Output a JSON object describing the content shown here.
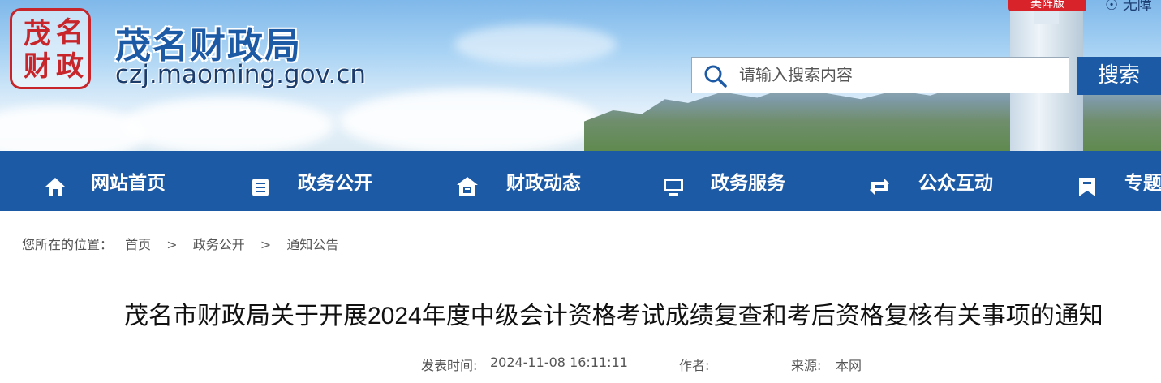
{
  "header": {
    "seal_chars": [
      "茂",
      "名",
      "财",
      "政"
    ],
    "site_name": "茂名财政局",
    "site_url": "czj.maoming.gov.cn",
    "top_badge": "美阵版",
    "top_right_text": "无障"
  },
  "search": {
    "placeholder": "请输入搜索内容",
    "value": "",
    "button_label": "搜索"
  },
  "nav": {
    "items": [
      {
        "label": "网站首页",
        "icon": "home-icon"
      },
      {
        "label": "政务公开",
        "icon": "document-list-icon"
      },
      {
        "label": "财政动态",
        "icon": "house-news-icon"
      },
      {
        "label": "政务服务",
        "icon": "monitor-icon"
      },
      {
        "label": "公众互动",
        "icon": "interaction-icon"
      },
      {
        "label": "专题",
        "icon": "bookmark-icon"
      }
    ]
  },
  "breadcrumb": {
    "prefix": "您所在的位置：",
    "items": [
      "首页",
      "政务公开",
      "通知公告"
    ],
    "separator": ">"
  },
  "article": {
    "title": "茂名市财政局关于开展2024年度中级会计资格考试成绩复查和考后资格复核有关事项的通知",
    "publish_label": "发表时间:",
    "publish_time": "2024-11-08 16:11:11",
    "author_label": "作者:",
    "author": "",
    "source_label": "来源:",
    "source": "本网"
  },
  "colors": {
    "brand_blue": "#1d5aa6",
    "seal_red": "#c8252b"
  }
}
